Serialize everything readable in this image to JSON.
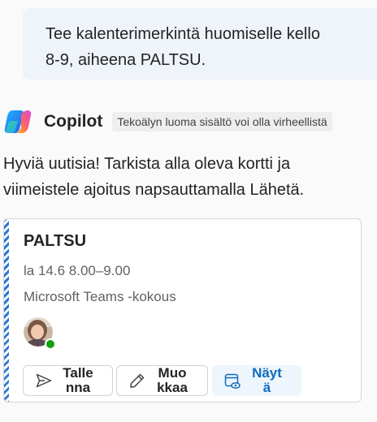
{
  "user_message": {
    "lines": [
      "Tee kalenterimerkintä huomiselle kello",
      "8-9, aiheena PALTSU."
    ]
  },
  "copilot": {
    "icon": "copilot-logo-icon",
    "name": "Copilot",
    "disclaimer": "Tekoälyn luoma sisältö voi olla virheellistä"
  },
  "reply": {
    "lines": [
      "Hyviä uutisia! Tarkista alla oleva kortti ja",
      "viimeistele ajoitus napsauttamalla Lähetä."
    ]
  },
  "event_card": {
    "title": "PALTSU",
    "date_time": "la 14.6 8.00–9.00",
    "meeting_type": "Microsoft Teams -kokous",
    "attendee_status": "available",
    "accent_color": "#2b78d6",
    "buttons": {
      "save": {
        "lines": [
          "Talle",
          "nna"
        ],
        "icon": "send-icon"
      },
      "edit": {
        "lines": [
          "Muo",
          "kkaa"
        ],
        "icon": "pencil-icon"
      },
      "view": {
        "lines": [
          "Näyt",
          "ä"
        ],
        "icon": "calendar-view-icon"
      }
    }
  }
}
